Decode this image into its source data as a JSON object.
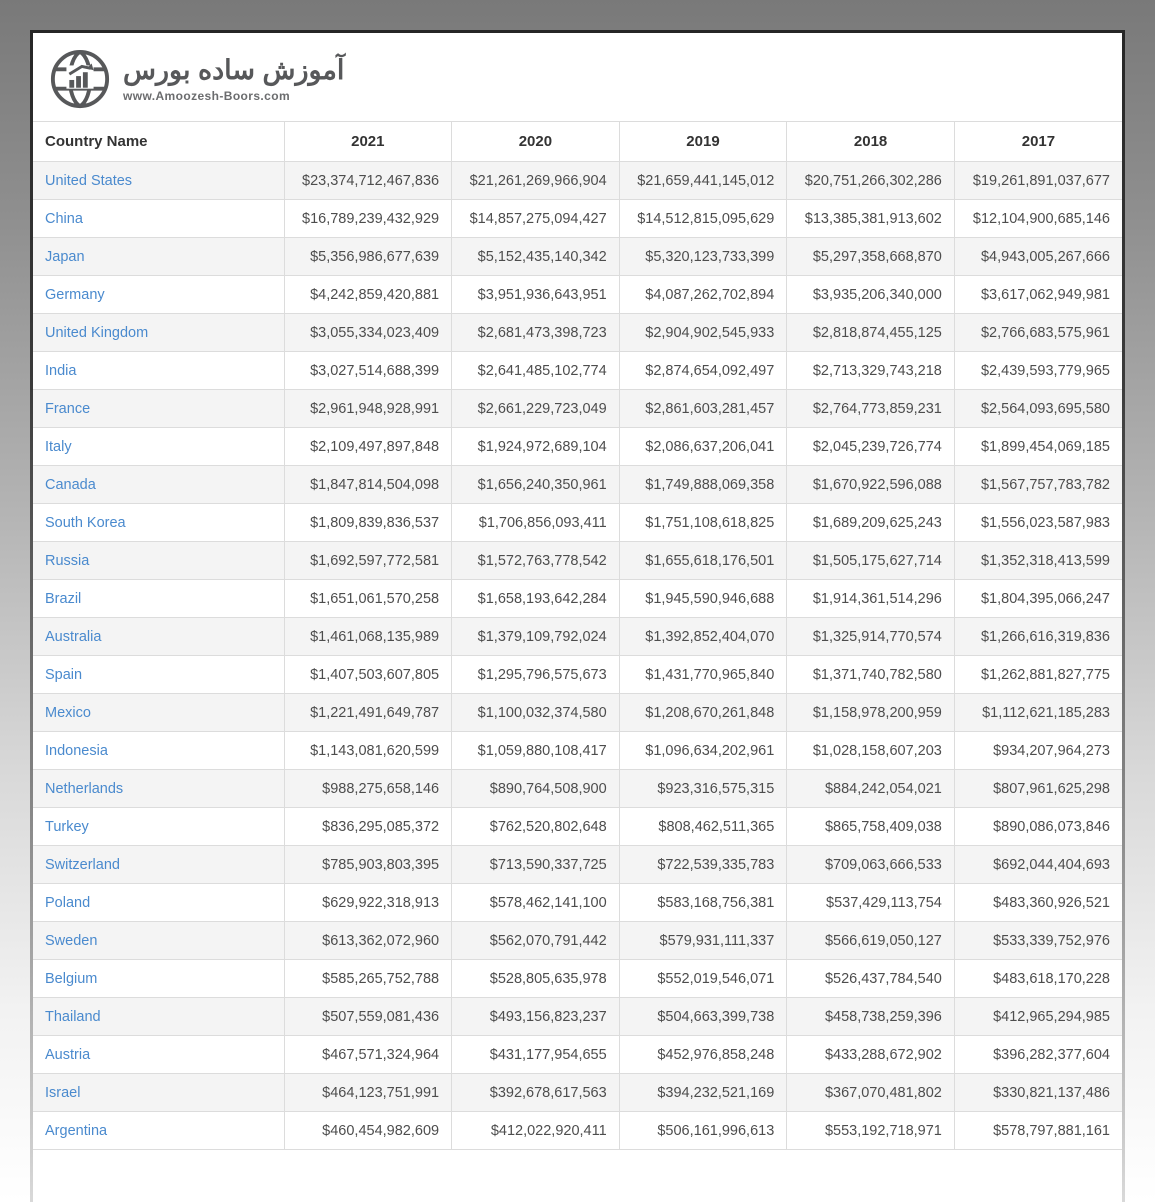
{
  "brand": {
    "title_fa": "آموزش ساده بورس",
    "website": "www.Amoozesh-Boors.com",
    "logo_icon": "globe-chart-icon",
    "logo_color": "#57585a"
  },
  "colors": {
    "link_blue": "#4a8ace",
    "stripe_gray": "#f4f4f4",
    "grid_line": "#dcdcdc",
    "header_text": "#333333",
    "value_text": "#4d4d4d",
    "frame_dark": "#2e2e2e"
  },
  "table": {
    "columns": [
      "Country Name",
      "2021",
      "2020",
      "2019",
      "2018",
      "2017"
    ],
    "rows": [
      {
        "country": "United States",
        "values": [
          "$23,374,712,467,836",
          "$21,261,269,966,904",
          "$21,659,441,145,012",
          "$20,751,266,302,286",
          "$19,261,891,037,677"
        ]
      },
      {
        "country": "China",
        "values": [
          "$16,789,239,432,929",
          "$14,857,275,094,427",
          "$14,512,815,095,629",
          "$13,385,381,913,602",
          "$12,104,900,685,146"
        ]
      },
      {
        "country": "Japan",
        "values": [
          "$5,356,986,677,639",
          "$5,152,435,140,342",
          "$5,320,123,733,399",
          "$5,297,358,668,870",
          "$4,943,005,267,666"
        ]
      },
      {
        "country": "Germany",
        "values": [
          "$4,242,859,420,881",
          "$3,951,936,643,951",
          "$4,087,262,702,894",
          "$3,935,206,340,000",
          "$3,617,062,949,981"
        ]
      },
      {
        "country": "United Kingdom",
        "values": [
          "$3,055,334,023,409",
          "$2,681,473,398,723",
          "$2,904,902,545,933",
          "$2,818,874,455,125",
          "$2,766,683,575,961"
        ]
      },
      {
        "country": "India",
        "values": [
          "$3,027,514,688,399",
          "$2,641,485,102,774",
          "$2,874,654,092,497",
          "$2,713,329,743,218",
          "$2,439,593,779,965"
        ]
      },
      {
        "country": "France",
        "values": [
          "$2,961,948,928,991",
          "$2,661,229,723,049",
          "$2,861,603,281,457",
          "$2,764,773,859,231",
          "$2,564,093,695,580"
        ]
      },
      {
        "country": "Italy",
        "values": [
          "$2,109,497,897,848",
          "$1,924,972,689,104",
          "$2,086,637,206,041",
          "$2,045,239,726,774",
          "$1,899,454,069,185"
        ]
      },
      {
        "country": "Canada",
        "values": [
          "$1,847,814,504,098",
          "$1,656,240,350,961",
          "$1,749,888,069,358",
          "$1,670,922,596,088",
          "$1,567,757,783,782"
        ]
      },
      {
        "country": "South Korea",
        "values": [
          "$1,809,839,836,537",
          "$1,706,856,093,411",
          "$1,751,108,618,825",
          "$1,689,209,625,243",
          "$1,556,023,587,983"
        ]
      },
      {
        "country": "Russia",
        "values": [
          "$1,692,597,772,581",
          "$1,572,763,778,542",
          "$1,655,618,176,501",
          "$1,505,175,627,714",
          "$1,352,318,413,599"
        ]
      },
      {
        "country": "Brazil",
        "values": [
          "$1,651,061,570,258",
          "$1,658,193,642,284",
          "$1,945,590,946,688",
          "$1,914,361,514,296",
          "$1,804,395,066,247"
        ]
      },
      {
        "country": "Australia",
        "values": [
          "$1,461,068,135,989",
          "$1,379,109,792,024",
          "$1,392,852,404,070",
          "$1,325,914,770,574",
          "$1,266,616,319,836"
        ]
      },
      {
        "country": "Spain",
        "values": [
          "$1,407,503,607,805",
          "$1,295,796,575,673",
          "$1,431,770,965,840",
          "$1,371,740,782,580",
          "$1,262,881,827,775"
        ]
      },
      {
        "country": "Mexico",
        "values": [
          "$1,221,491,649,787",
          "$1,100,032,374,580",
          "$1,208,670,261,848",
          "$1,158,978,200,959",
          "$1,112,621,185,283"
        ]
      },
      {
        "country": "Indonesia",
        "values": [
          "$1,143,081,620,599",
          "$1,059,880,108,417",
          "$1,096,634,202,961",
          "$1,028,158,607,203",
          "$934,207,964,273"
        ]
      },
      {
        "country": "Netherlands",
        "values": [
          "$988,275,658,146",
          "$890,764,508,900",
          "$923,316,575,315",
          "$884,242,054,021",
          "$807,961,625,298"
        ]
      },
      {
        "country": "Turkey",
        "values": [
          "$836,295,085,372",
          "$762,520,802,648",
          "$808,462,511,365",
          "$865,758,409,038",
          "$890,086,073,846"
        ]
      },
      {
        "country": "Switzerland",
        "values": [
          "$785,903,803,395",
          "$713,590,337,725",
          "$722,539,335,783",
          "$709,063,666,533",
          "$692,044,404,693"
        ]
      },
      {
        "country": "Poland",
        "values": [
          "$629,922,318,913",
          "$578,462,141,100",
          "$583,168,756,381",
          "$537,429,113,754",
          "$483,360,926,521"
        ]
      },
      {
        "country": "Sweden",
        "values": [
          "$613,362,072,960",
          "$562,070,791,442",
          "$579,931,111,337",
          "$566,619,050,127",
          "$533,339,752,976"
        ]
      },
      {
        "country": "Belgium",
        "values": [
          "$585,265,752,788",
          "$528,805,635,978",
          "$552,019,546,071",
          "$526,437,784,540",
          "$483,618,170,228"
        ]
      },
      {
        "country": "Thailand",
        "values": [
          "$507,559,081,436",
          "$493,156,823,237",
          "$504,663,399,738",
          "$458,738,259,396",
          "$412,965,294,985"
        ]
      },
      {
        "country": "Austria",
        "values": [
          "$467,571,324,964",
          "$431,177,954,655",
          "$452,976,858,248",
          "$433,288,672,902",
          "$396,282,377,604"
        ]
      },
      {
        "country": "Israel",
        "values": [
          "$464,123,751,991",
          "$392,678,617,563",
          "$394,232,521,169",
          "$367,070,481,802",
          "$330,821,137,486"
        ]
      },
      {
        "country": "Argentina",
        "values": [
          "$460,454,982,609",
          "$412,022,920,411",
          "$506,161,996,613",
          "$553,192,718,971",
          "$578,797,881,161"
        ]
      }
    ]
  }
}
